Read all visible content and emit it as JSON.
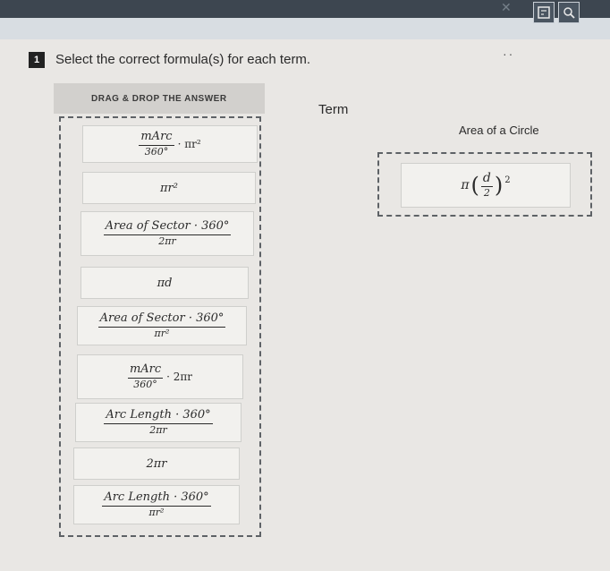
{
  "toolbar": {
    "icons": [
      "close-icon",
      "calculator-icon",
      "search-icon"
    ]
  },
  "question": {
    "number": "1",
    "prompt": "Select the correct formula(s) for each term."
  },
  "answer_bank": {
    "header": "DRAG & DROP THE ANSWER",
    "tiles": [
      {
        "num": "mArc",
        "den": "360°",
        "suffix": "· πr²"
      },
      {
        "text": "πr²"
      },
      {
        "num": "Area of Sector · 360°",
        "den": "2πr"
      },
      {
        "text": "πd"
      },
      {
        "num": "Area of Sector · 360°",
        "den": "πr²"
      },
      {
        "num": "mArc",
        "den": "360°",
        "suffix": "· 2πr"
      },
      {
        "num": "Arc Length · 360°",
        "den": "2πr"
      },
      {
        "text": "2πr"
      },
      {
        "num": "Arc Length · 360°",
        "den": "πr²"
      }
    ]
  },
  "terms": {
    "header": "Term",
    "items": [
      {
        "name": "Area of a Circle",
        "placed_answer": {
          "prefix": "π",
          "num": "d",
          "den": "2",
          "exp": "2"
        }
      }
    ]
  }
}
